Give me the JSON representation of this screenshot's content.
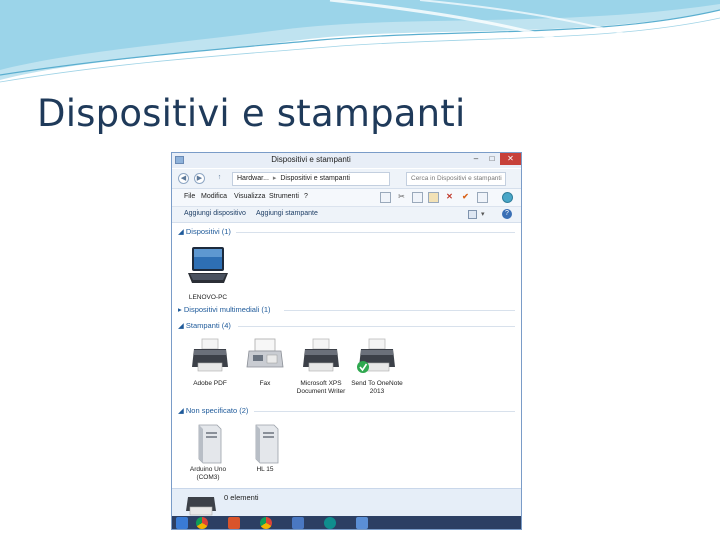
{
  "slide": {
    "title": "Dispositivi e stampanti"
  },
  "window": {
    "title": "Dispositivi e stampanti",
    "buttons": {
      "minimize": "–",
      "maximize": "□",
      "close": "✕"
    },
    "address": {
      "crumb1": "Hardwar...",
      "sep": "▸",
      "crumb2": "Dispositivi e stampanti"
    },
    "search_placeholder": "Cerca in Dispositivi e stampanti",
    "nav": {
      "back": "◀",
      "forward": "▶",
      "up": "↑"
    },
    "menu": [
      {
        "label": "File"
      },
      {
        "label": "Modifica"
      },
      {
        "label": "Visualizza"
      },
      {
        "label": "Strumenti"
      },
      {
        "label": "?"
      }
    ],
    "commands": {
      "add_device": "Aggiungi dispositivo",
      "add_printer": "Aggiungi stampante",
      "help": "?"
    },
    "groups": {
      "devices": "Dispositivi (1)",
      "multimedia": "Dispositivi multimediali (1)",
      "printers": "Stampanti (4)",
      "unspecified": "Non specificato (2)"
    },
    "devices": [
      {
        "label": "LENOVO-PC"
      }
    ],
    "printers": [
      {
        "label": "Adobe PDF"
      },
      {
        "label": "Fax"
      },
      {
        "label": "Microsoft XPS Document Writer"
      },
      {
        "label": "Send To OneNote 2013"
      }
    ],
    "unspecified": [
      {
        "label": "Arduino Uno (COM3)"
      },
      {
        "label": "HL 15"
      }
    ],
    "status": "0 elementi",
    "colors": {
      "accent": "#1e5a9a",
      "close": "#c7413a",
      "taskbar": "#2c3f63",
      "title": "#1f3a5a"
    },
    "icons": {
      "laptop": "laptop-icon",
      "printer": "printer-icon",
      "fax": "fax-icon",
      "check": "checkmark-icon",
      "tower": "computer-tower-icon"
    }
  }
}
